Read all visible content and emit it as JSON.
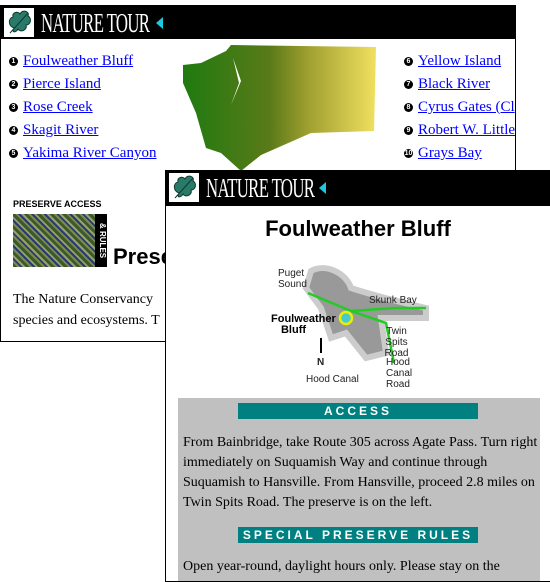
{
  "overview": {
    "brand": "NATURE TOUR",
    "left_links": [
      {
        "n": "1",
        "label": "Foulweather Bluff"
      },
      {
        "n": "2",
        "label": "Pierce Island"
      },
      {
        "n": "3",
        "label": "Rose Creek"
      },
      {
        "n": "4",
        "label": "Skagit River"
      },
      {
        "n": "5",
        "label": "Yakima River Canyon"
      }
    ],
    "right_links": [
      {
        "n": "6",
        "label": "Yellow Island"
      },
      {
        "n": "7",
        "label": "Black River"
      },
      {
        "n": "8",
        "label": "Cyrus Gates (Cl"
      },
      {
        "n": "9",
        "label": "Robert W. Little"
      },
      {
        "n": "10",
        "label": "Grays Bay"
      }
    ],
    "preserve_access": "PRESERVE ACCESS",
    "rules_tab": "& RULES",
    "heading": "Prese",
    "intro_lines": [
      "The Nature Conservancy",
      "species and ecosystems. T"
    ]
  },
  "detail": {
    "brand": "NATURE TOUR",
    "title": "Foulweather Bluff",
    "map_labels": {
      "puget": "Puget Sound",
      "skunk": "Skunk Bay",
      "bluff": "Foulweather Bluff",
      "twin": "Twin Spits Road",
      "north": "N",
      "hood": "Hood Canal",
      "hoodroad": "Hood Canal Road"
    },
    "access_heading": "ACCESS",
    "access_text": "From Bainbridge, take Route 305 across Agate Pass. Turn right immediately on Suquamish Way and continue through Suquamish to Hansville. From Hansville, proceed 2.8 miles on Twin Spits Road. The preserve is on the left.",
    "rules_heading": "SPECIAL PRESERVE RULES",
    "rules_text": "Open year-round, daylight hours only. Please stay on the"
  },
  "colors": {
    "teal": "#008080",
    "link": "#0000ff",
    "panel": "#c0c0c0"
  }
}
